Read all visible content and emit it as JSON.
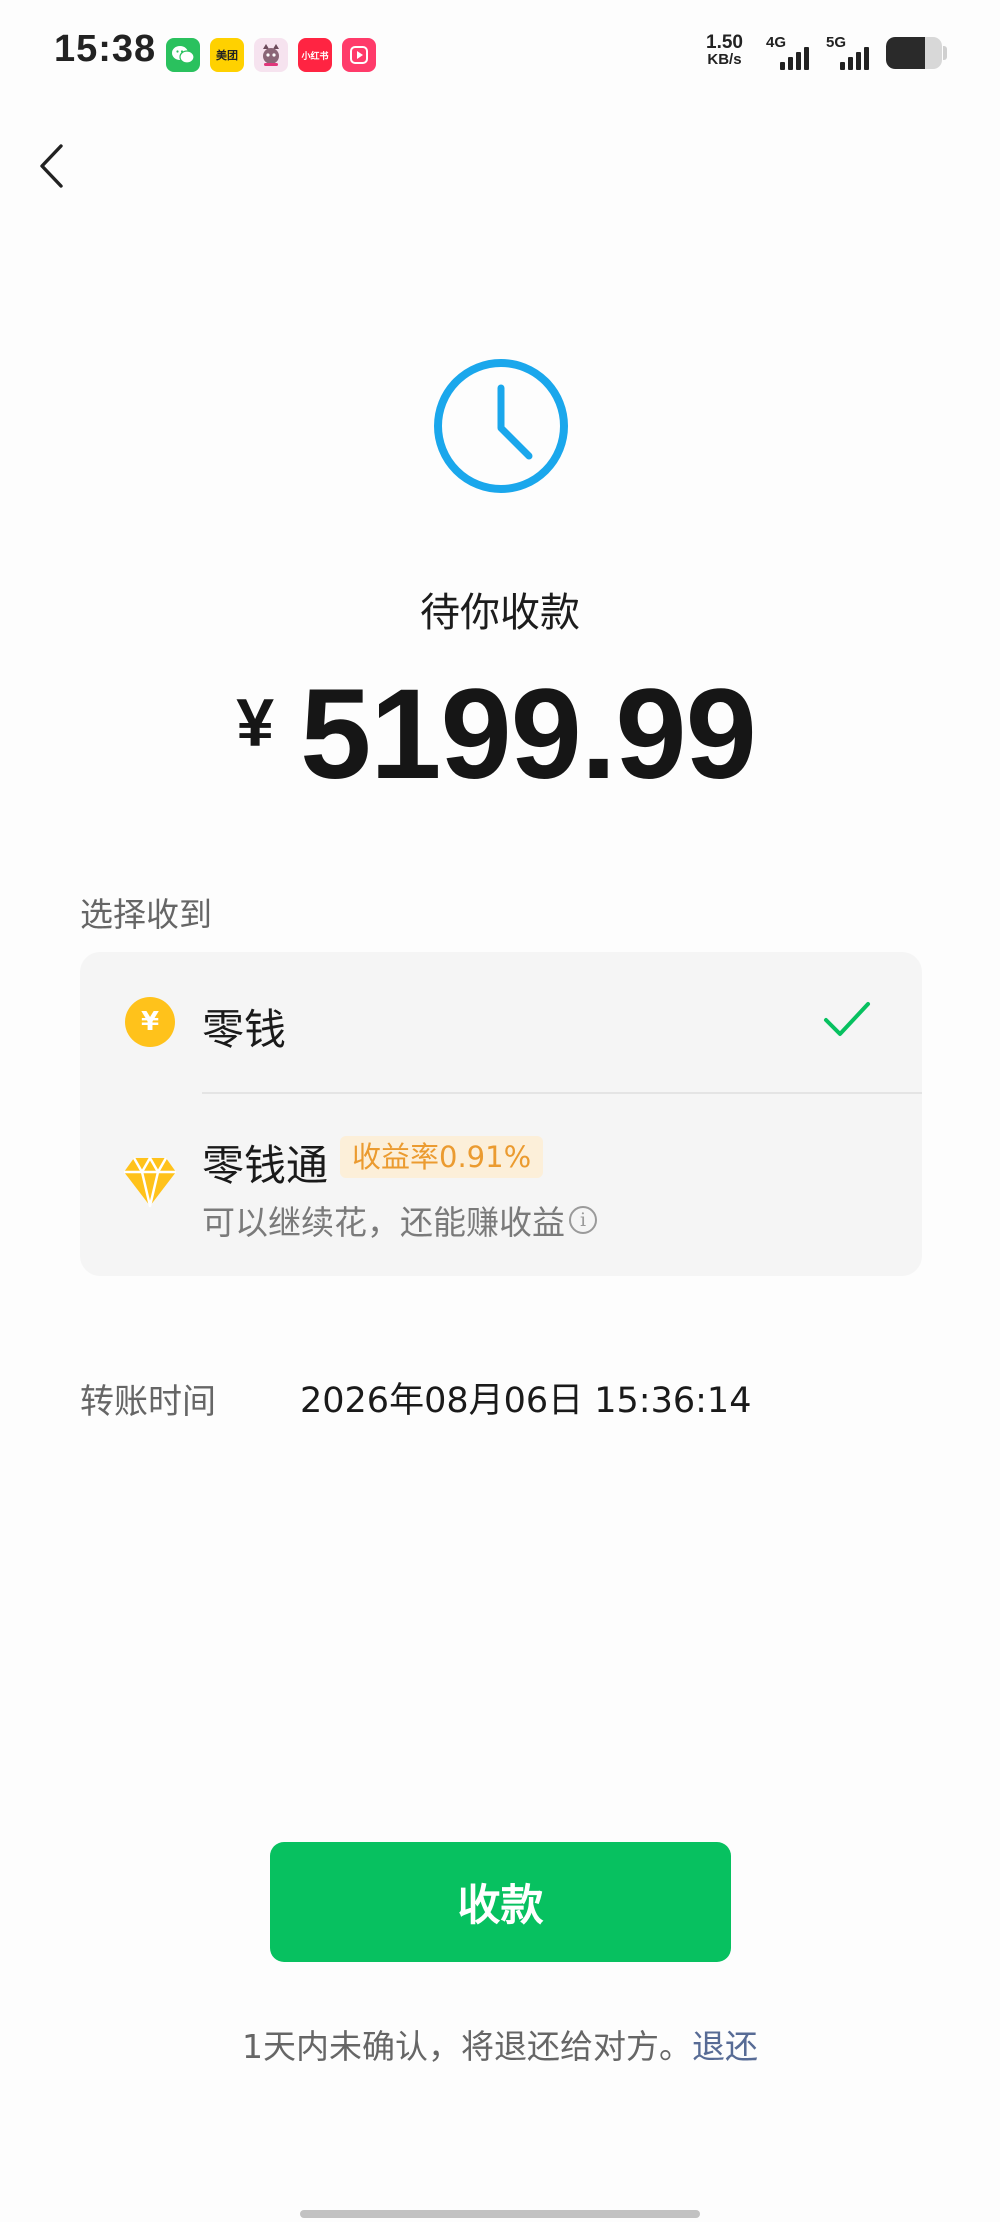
{
  "status_bar": {
    "time": "15:38",
    "apps": [
      {
        "name": "wechat-app-icon",
        "label": ""
      },
      {
        "name": "meituan-app-icon",
        "label": "美团"
      },
      {
        "name": "mascot-app-icon",
        "label": ""
      },
      {
        "name": "xiaohongshu-app-icon",
        "label": "小红书"
      },
      {
        "name": "video-app-icon",
        "label": ""
      }
    ],
    "net_speed_value": "1.50",
    "net_speed_unit": "KB/s",
    "signal_1_label": "4G",
    "signal_2_label": "5G",
    "battery_level": 0.7
  },
  "header": {
    "back_icon": "chevron-left-icon"
  },
  "status": {
    "icon": "clock-icon",
    "accent_color": "#1aa7ec",
    "title": "待你收款",
    "currency": "¥",
    "amount": "5199.99"
  },
  "receive_options": {
    "label": "选择收到",
    "items": [
      {
        "label": "零钱",
        "icon": "yen-coin-icon",
        "icon_text": "¥",
        "selected": true
      },
      {
        "label": "零钱通",
        "icon": "diamond-icon",
        "badge": "收益率0.91%",
        "description": "可以继续花，还能赚收益",
        "info_icon": "i",
        "selected": false
      }
    ]
  },
  "transfer_time": {
    "label": "转账时间",
    "value": "2026年08月06日 15:36:14"
  },
  "footer": {
    "receive_button": "收款",
    "notice_text": "1天内未确认，将退还给对方。",
    "return_link": "退还",
    "primary_color": "#07c160",
    "link_color": "#576b95"
  }
}
